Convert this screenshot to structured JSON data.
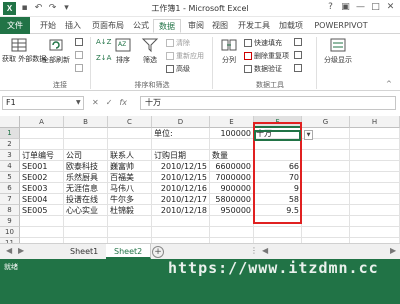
{
  "titlebar": {
    "title": "工作簿1 - Microsoft Excel",
    "logo": "X"
  },
  "tabs": [
    "文件",
    "开始",
    "插入",
    "页面布局",
    "公式",
    "数据",
    "审阅",
    "视图",
    "开发工具",
    "加载项",
    "POWERPIVOT"
  ],
  "ribbon": {
    "get_external": "获取\n外部数据",
    "refresh_all": "全部刷新",
    "sort_az": "A↓Z",
    "sort_za": "Z↓A",
    "sort": "排序",
    "filter": "筛选",
    "clear": "清除",
    "reapply": "重新应用",
    "advanced": "高级",
    "text_to_columns": "分列",
    "flash_fill": "快速填充",
    "remove_dup": "删除重复项",
    "validation": "数据验证",
    "outline": "分级显示",
    "group_connect": "连接",
    "group_sort": "排序和筛选",
    "group_tools": "数据工具"
  },
  "formula_bar": {
    "name_box": "F1",
    "fx": "fx",
    "formula": "十万"
  },
  "columns": [
    "A",
    "B",
    "C",
    "D",
    "E",
    "F",
    "G",
    "H"
  ],
  "rows": [
    "1",
    "2",
    "3",
    "4",
    "5",
    "6",
    "7",
    "8",
    "9",
    "10",
    "11"
  ],
  "cells": {
    "d1": "单位:",
    "e1": "100000",
    "f1": "十万",
    "headers": [
      "订单编号",
      "公司",
      "联系人",
      "订购日期",
      "数量"
    ],
    "data": [
      [
        "SE001",
        "欧泰科技",
        "巍富帅",
        "2010/12/15",
        "6600000",
        "66"
      ],
      [
        "SE002",
        "乐然厨具",
        "百福美",
        "2010/12/15",
        "7000000",
        "70"
      ],
      [
        "SE003",
        "无涯信息",
        "马伟八",
        "2010/12/16",
        "900000",
        "9"
      ],
      [
        "SE004",
        "投谱在线",
        "牛尔多",
        "2010/12/17",
        "5800000",
        "58"
      ],
      [
        "SE005",
        "心心实业",
        "杜锦毅",
        "2010/12/18",
        "950000",
        "9.5"
      ]
    ]
  },
  "sheets": [
    "Sheet1",
    "Sheet2"
  ],
  "status": {
    "ready": "就绪",
    "watermark": "https://www.itzdmn.cc"
  },
  "colors": {
    "accent": "#217346",
    "highlight": "#e02020"
  }
}
